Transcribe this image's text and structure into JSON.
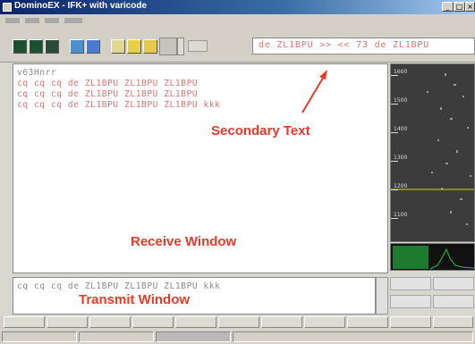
{
  "window": {
    "title": "DominoEX - IFK+ with varicode"
  },
  "secondary_text": "de ZL1BPU >> << 73 de ZL1BPU",
  "receive": {
    "lines": [
      "v63Hnrr",
      "cq cq cq de ZL1BPU ZL1BPU ZL1BPU",
      "cq cq cq de ZL1BPU ZL1BPU ZL1BPU",
      "cq cq cq de ZL1BPU ZL1BPU ZL1BPU kkk"
    ]
  },
  "transmit": {
    "text": "cq cq cq de ZL1BPU ZL1BPU ZL1BPU kkk"
  },
  "waterfall": {
    "scale": [
      "1600",
      "1500",
      "1400",
      "1300",
      "1200",
      "1100"
    ]
  },
  "annotations": {
    "secondary": "Secondary Text",
    "receive": "Receive Window",
    "transmit": "Transmit Window"
  },
  "colors": {
    "text_pink": "#e27070",
    "annotation_red": "#e8392a",
    "title_blue": "#0a246a",
    "marker_yellow": "#e0d020",
    "spectrum_green": "#30c030"
  }
}
